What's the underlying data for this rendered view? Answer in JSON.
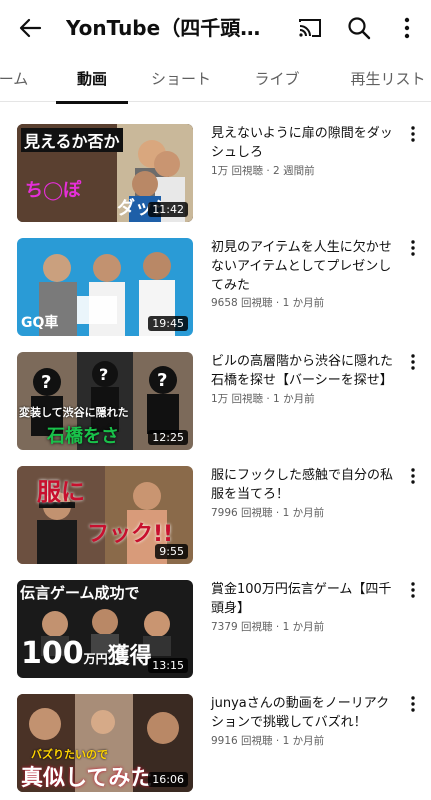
{
  "header": {
    "title": "YonTube（四千頭身）",
    "back_icon": "arrow-back-icon",
    "cast_icon": "cast-icon",
    "search_icon": "search-icon",
    "more_icon": "more-vert-icon"
  },
  "tabs": [
    {
      "label": "ホーム",
      "active": false
    },
    {
      "label": "動画",
      "active": true
    },
    {
      "label": "ショート",
      "active": false
    },
    {
      "label": "ライブ",
      "active": false
    },
    {
      "label": "再生リスト",
      "active": false
    }
  ],
  "videos": [
    {
      "title": "見えないように扉の隙間をダッシュしろ",
      "views": "1万 回視聴",
      "age": "2 週間前",
      "duration": "11:42",
      "thumb_text": [
        "見えるか否か",
        "ち◯ぽ",
        "ダッシ"
      ]
    },
    {
      "title": "初見のアイテムを人生に欠かせないアイテムとしてプレゼンしてみた",
      "views": "9658 回視聴",
      "age": "1 か月前",
      "duration": "19:45",
      "thumb_text": [
        "GQ",
        "車"
      ]
    },
    {
      "title": "ビルの高層階から渋谷に隠れた石橋を探せ【バーシーを探せ】",
      "views": "1万 回視聴",
      "age": "1 か月前",
      "duration": "12:25",
      "thumb_text": [
        "変装して渋谷に隠れた",
        "石橋をさ"
      ]
    },
    {
      "title": "服にフックした感触で自分の私服を当てろ！",
      "views": "7996 回視聴",
      "age": "1 か月前",
      "duration": "9:55",
      "thumb_text": [
        "服に",
        "フック!!"
      ]
    },
    {
      "title": "賞金100万円伝言ゲーム【四千頭身】",
      "views": "7379 回視聴",
      "age": "1 か月前",
      "duration": "13:15",
      "thumb_text": [
        "伝言ゲーム成功で",
        "100",
        "万円",
        "獲得"
      ]
    },
    {
      "title": "junyaさんの動画をノーリアクションで挑戦してバズれ！",
      "views": "9916 回視聴",
      "age": "1 か月前",
      "duration": "16:06",
      "thumb_text": [
        "バズりたいので",
        "真似してみた"
      ]
    }
  ],
  "colors": {
    "text_primary": "#0f0f0f",
    "text_secondary": "#606060",
    "divider": "#e5e5e5"
  }
}
